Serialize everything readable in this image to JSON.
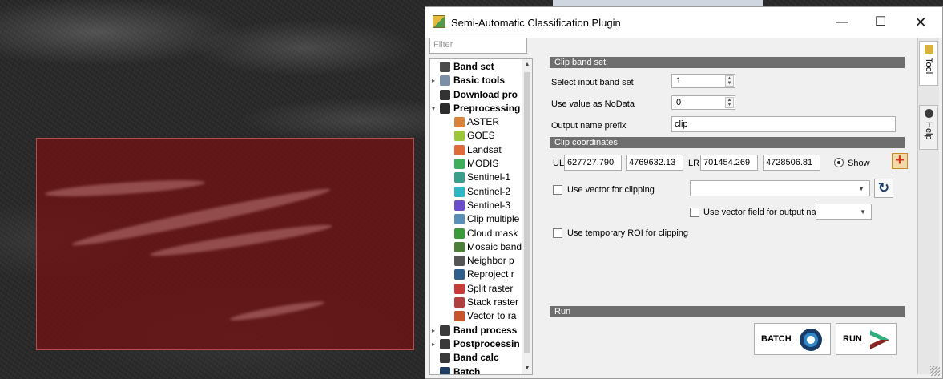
{
  "window": {
    "title": "Semi-Automatic Classification Plugin",
    "minimize": "—",
    "maximize": "☐",
    "close": "✕"
  },
  "filter": {
    "placeholder": "Filter"
  },
  "tree": [
    {
      "label": "Band set",
      "level": "top",
      "arrow": "",
      "icon_color": "#4a4a4a",
      "icon": "band-set-icon"
    },
    {
      "label": "Basic tools",
      "level": "top",
      "arrow": "▸",
      "icon_color": "#7c8fa6",
      "icon": "basic-tools-icon"
    },
    {
      "label": "Download pro",
      "level": "top",
      "arrow": "",
      "icon_color": "#333333",
      "icon": "download-icon"
    },
    {
      "label": "Preprocessing",
      "level": "top",
      "arrow": "▾",
      "icon_color": "#2d2d2d",
      "icon": "preprocessing-icon"
    },
    {
      "label": "ASTER",
      "level": "sub",
      "icon_color": "#d9823b",
      "icon": "aster-icon"
    },
    {
      "label": "GOES",
      "level": "sub",
      "icon_color": "#9cc63a",
      "icon": "goes-icon"
    },
    {
      "label": "Landsat",
      "level": "sub",
      "icon_color": "#e06b3a",
      "icon": "landsat-icon"
    },
    {
      "label": "MODIS",
      "level": "sub",
      "icon_color": "#3fae5b",
      "icon": "modis-icon"
    },
    {
      "label": "Sentinel-1",
      "level": "sub",
      "icon_color": "#3b9e8a",
      "icon": "sentinel-1-icon"
    },
    {
      "label": "Sentinel-2",
      "level": "sub",
      "icon_color": "#2fb7c6",
      "icon": "sentinel-2-icon"
    },
    {
      "label": "Sentinel-3",
      "level": "sub",
      "icon_color": "#6b4fc9",
      "icon": "sentinel-3-icon"
    },
    {
      "label": "Clip multiple",
      "level": "sub",
      "icon_color": "#5a8fb8",
      "icon": "clip-icon"
    },
    {
      "label": "Cloud mask",
      "level": "sub",
      "icon_color": "#3c9a3c",
      "icon": "cloud-mask-icon"
    },
    {
      "label": "Mosaic band",
      "level": "sub",
      "icon_color": "#4f7d3a",
      "icon": "mosaic-icon"
    },
    {
      "label": "Neighbor p",
      "level": "sub",
      "icon_color": "#555555",
      "icon": "neighbor-icon"
    },
    {
      "label": "Reproject r",
      "level": "sub",
      "icon_color": "#2f5f8a",
      "icon": "reproject-icon"
    },
    {
      "label": "Split raster",
      "level": "sub",
      "icon_color": "#c83b3b",
      "icon": "split-raster-icon"
    },
    {
      "label": "Stack raster",
      "level": "sub",
      "icon_color": "#b04040",
      "icon": "stack-raster-icon"
    },
    {
      "label": "Vector to ra",
      "level": "sub",
      "icon_color": "#c8552c",
      "icon": "vector-to-raster-icon"
    },
    {
      "label": "Band process",
      "level": "top",
      "arrow": "▸",
      "icon_color": "#3a3a3a",
      "icon": "band-processing-icon"
    },
    {
      "label": "Postprocessin",
      "level": "top",
      "arrow": "▸",
      "icon_color": "#3a3a3a",
      "icon": "postprocessing-icon"
    },
    {
      "label": "Band calc",
      "level": "top",
      "arrow": "",
      "icon_color": "#3a3a3a",
      "icon": "band-calc-icon"
    },
    {
      "label": "Batch",
      "level": "top",
      "arrow": "",
      "icon_color": "#1f3d63",
      "icon": "batch-icon"
    }
  ],
  "clip_band_set": {
    "header": "Clip band set",
    "input_band_set_label": "Select input band set",
    "input_band_set_value": "1",
    "nodata_label": "Use value as NoData",
    "nodata_value": "0",
    "prefix_label": "Output name prefix",
    "prefix_value": "clip"
  },
  "clip_coordinates": {
    "header": "Clip coordinates",
    "ul_label": "UL",
    "ul_x": "627727.790",
    "ul_y": "4769632.13",
    "lr_label": "LR",
    "lr_x": "701454.269",
    "lr_y": "4728506.81",
    "show_label": "Show",
    "use_vector_label": "Use vector for clipping",
    "use_vector_field_label": "Use vector field for output na",
    "use_roi_label": "Use temporary ROI for clipping"
  },
  "run": {
    "header": "Run",
    "batch_label": "BATCH",
    "run_label": "RUN"
  },
  "dock_tabs": [
    "Tool",
    "Help"
  ]
}
